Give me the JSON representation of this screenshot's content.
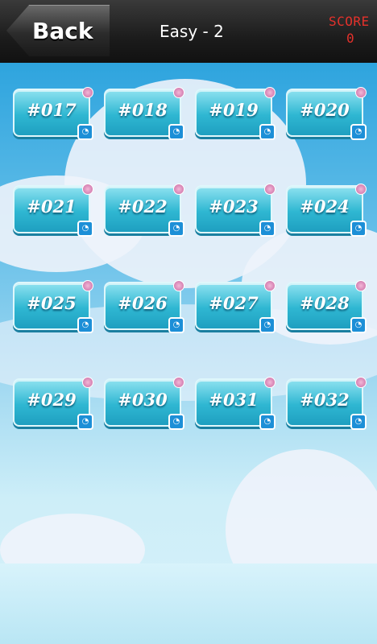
{
  "header": {
    "back_label": "Back",
    "level_title": "Easy - 2",
    "score_label": "SCORE",
    "score_value": "0"
  },
  "levels": [
    "#017",
    "#018",
    "#019",
    "#020",
    "#021",
    "#022",
    "#023",
    "#024",
    "#025",
    "#026",
    "#027",
    "#028",
    "#029",
    "#030",
    "#031",
    "#032"
  ],
  "colors": {
    "score_text": "#e4312b",
    "tile_top": "#8ee2f0",
    "tile_bottom": "#1e9fc0",
    "sky": "#2ea4de"
  }
}
